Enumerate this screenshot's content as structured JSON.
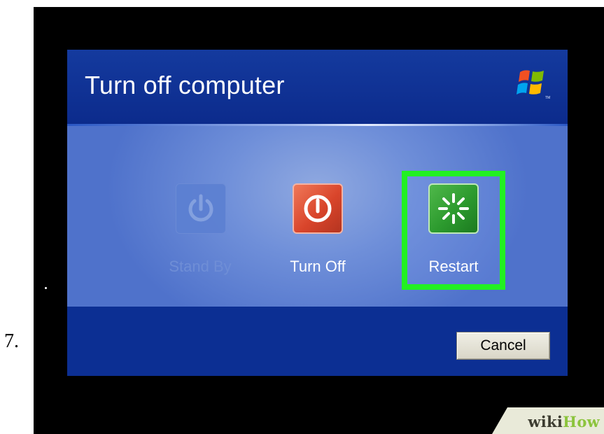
{
  "step": {
    "number": "7."
  },
  "dialog": {
    "title": "Turn off computer",
    "logo_icon": "windows-xp-flag-icon",
    "options": [
      {
        "label": "Stand By",
        "icon": "power-icon",
        "state": "disabled",
        "color": "#5c80d2"
      },
      {
        "label": "Turn Off",
        "icon": "power-icon",
        "state": "enabled",
        "color": "#d9452b"
      },
      {
        "label": "Restart",
        "icon": "restart-icon",
        "state": "highlighted",
        "color": "#2c9a2e"
      }
    ],
    "highlight_color": "#22f022",
    "cancel_label": "Cancel"
  },
  "watermark": {
    "part1": "wiki",
    "part2": "How"
  },
  "colors": {
    "dialog_blue": "#0a2d8f",
    "body_blue": "#6f8fd9",
    "wikihow_green": "#8cc43d"
  }
}
